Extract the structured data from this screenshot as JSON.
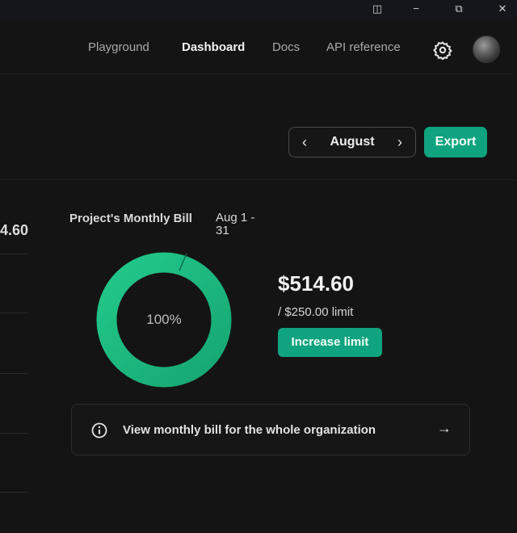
{
  "window_controls": {
    "panel": "◫",
    "minimize": "−",
    "restore": "⧉",
    "close": "✕"
  },
  "nav": {
    "links": [
      {
        "label": "Playground",
        "active": false
      },
      {
        "label": "Dashboard",
        "active": true
      },
      {
        "label": "Docs",
        "active": false
      },
      {
        "label": "API reference",
        "active": false
      }
    ],
    "settings_icon": "gear-icon",
    "avatar_icon": "user-avatar"
  },
  "toolbar": {
    "month": "August",
    "prev_icon": "‹",
    "next_icon": "›",
    "export_label": "Export"
  },
  "left_panel": {
    "value_fragment": "4.60"
  },
  "bill": {
    "title": "Project's Monthly Bill",
    "range": "Aug 1 - 31",
    "usage_percent_label": "100%",
    "usage_fraction": 1.0,
    "amount": "$514.60",
    "limit": "/ $250.00 limit",
    "increase_label": "Increase limit"
  },
  "org_link": {
    "text": "View monthly bill for the whole organization",
    "arrow": "→",
    "icon": "info-icon"
  },
  "colors": {
    "accent": "#10a37f",
    "ring_start": "#22c98a",
    "ring_end": "#16a672",
    "background": "#141414"
  }
}
